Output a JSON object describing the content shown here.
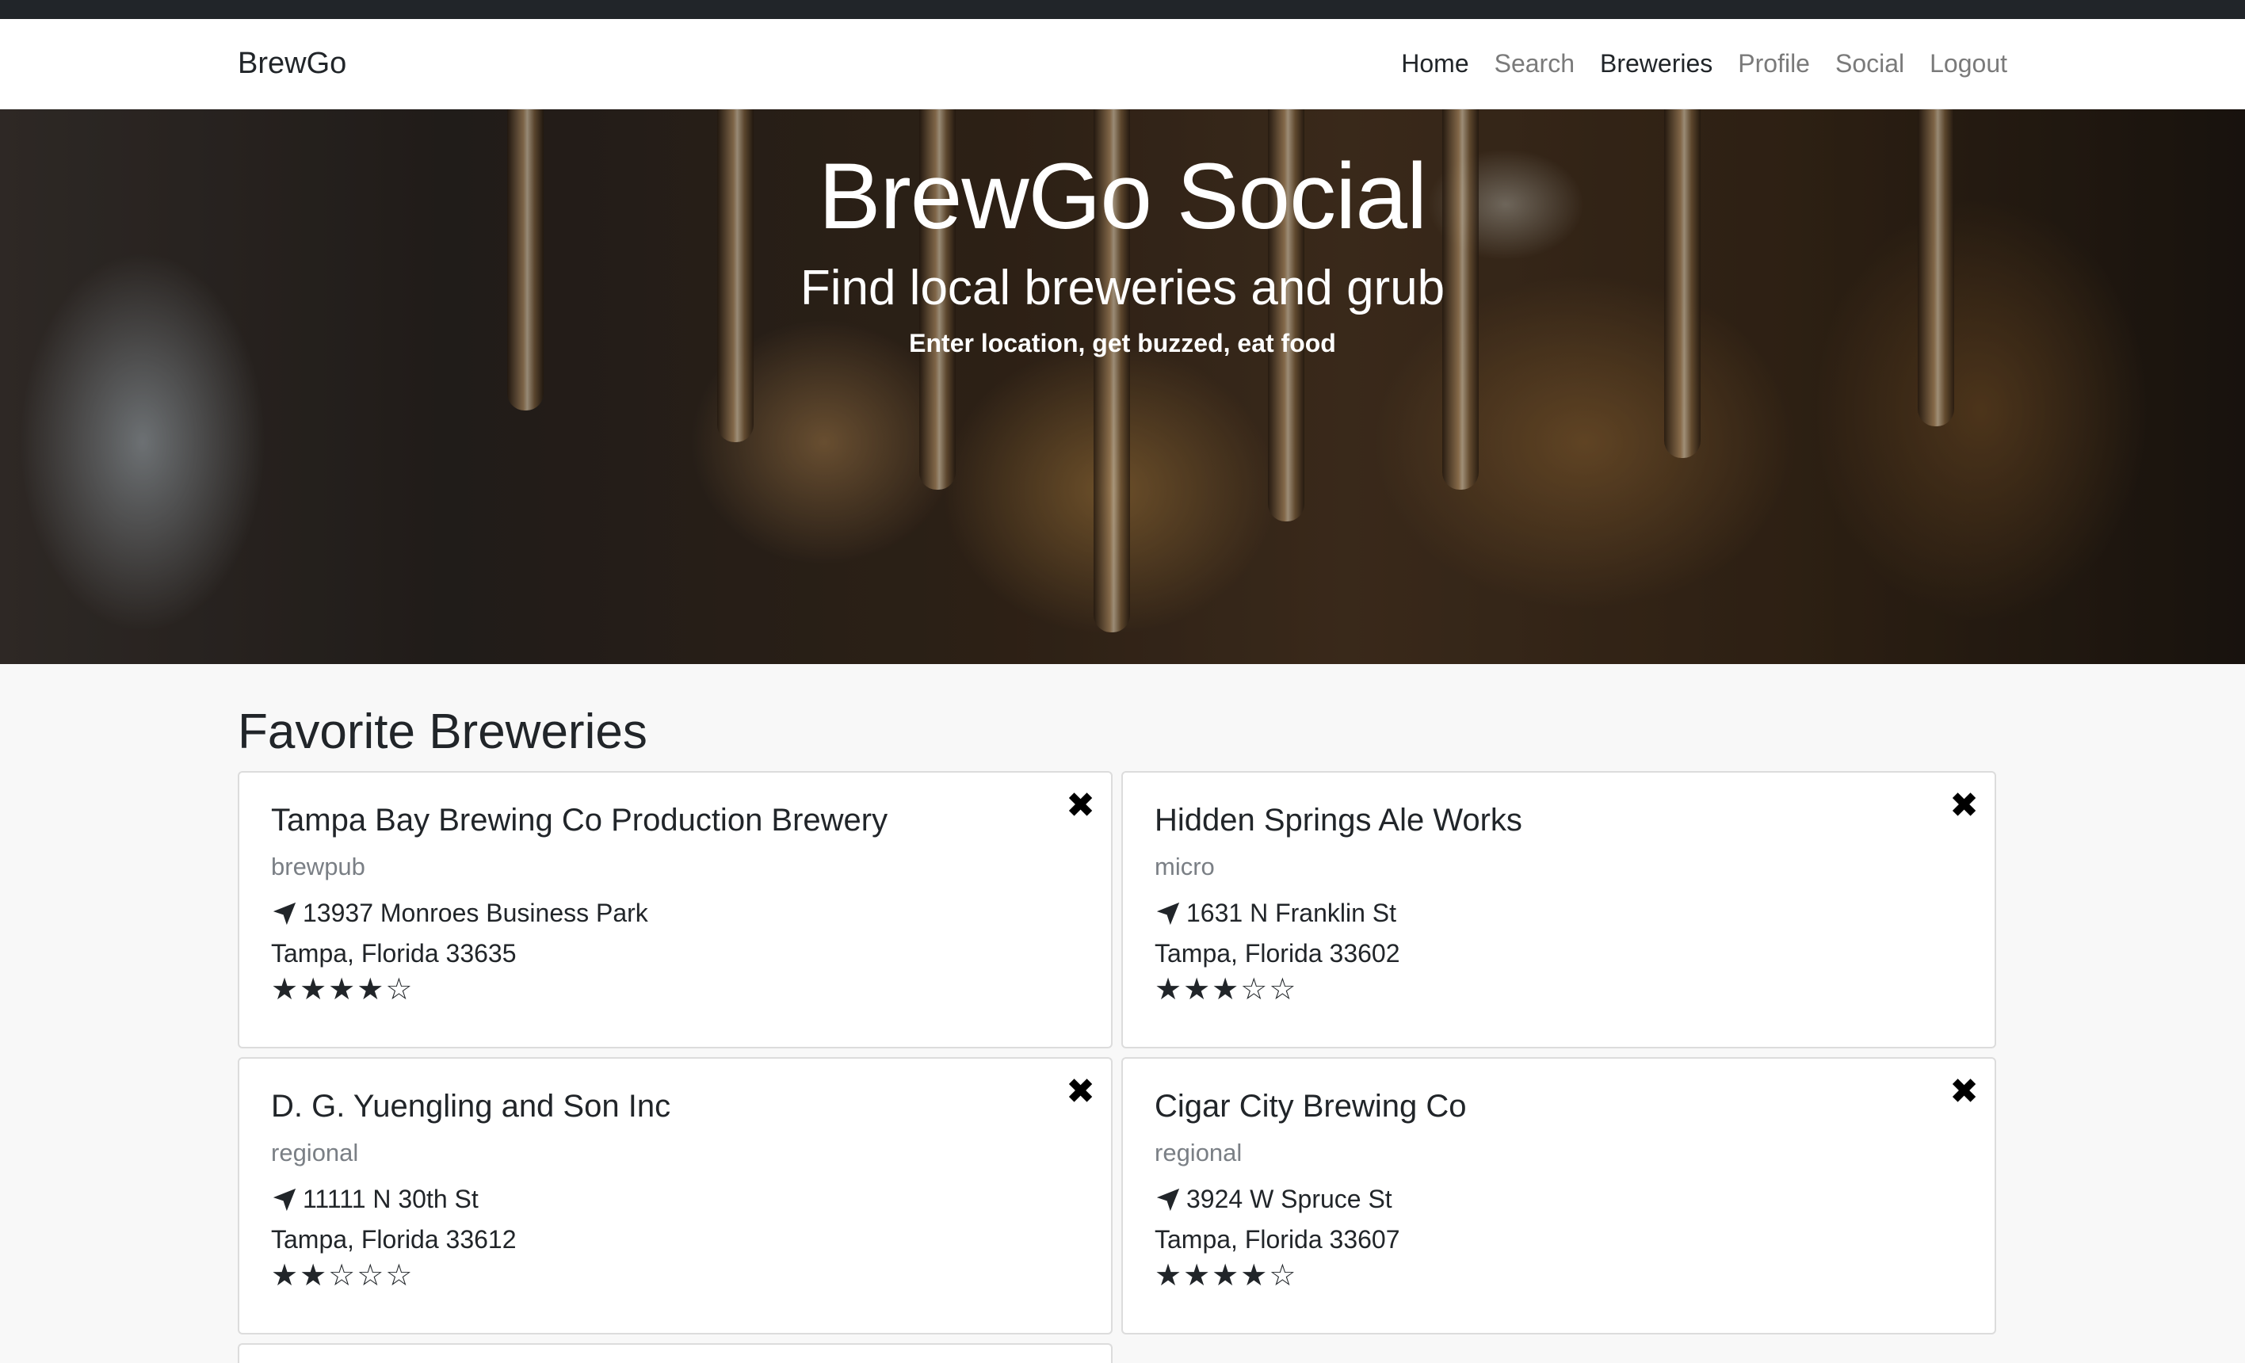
{
  "nav": {
    "brand": "BrewGo",
    "links": [
      "Home",
      "Search",
      "Breweries",
      "Profile",
      "Social",
      "Logout"
    ]
  },
  "hero": {
    "title": "BrewGo Social",
    "subtitle": "Find local breweries and grub",
    "tagline": "Enter location, get buzzed, eat food"
  },
  "section": {
    "title": "Favorite Breweries"
  },
  "breweries": [
    {
      "name": "Tampa Bay Brewing Co Production Brewery",
      "type": "brewpub",
      "street": "13937 Monroes Business Park",
      "city": "Tampa, Florida 33635",
      "rating": 4,
      "stars": "★★★★☆"
    },
    {
      "name": "Hidden Springs Ale Works",
      "type": "micro",
      "street": "1631 N Franklin St",
      "city": "Tampa, Florida 33602",
      "rating": 3,
      "stars": "★★★☆☆"
    },
    {
      "name": "D. G. Yuengling and Son Inc",
      "type": "regional",
      "street": "11111 N 30th St",
      "city": "Tampa, Florida 33612",
      "rating": 2,
      "stars": "★★☆☆☆"
    },
    {
      "name": "Cigar City Brewing Co",
      "type": "regional",
      "street": "3924 W Spruce St",
      "city": "Tampa, Florida 33607",
      "rating": 4,
      "stars": "★★★★☆"
    }
  ],
  "icons": {
    "remove": "close-icon",
    "location": "location-arrow-icon",
    "rating": "star-icon"
  }
}
